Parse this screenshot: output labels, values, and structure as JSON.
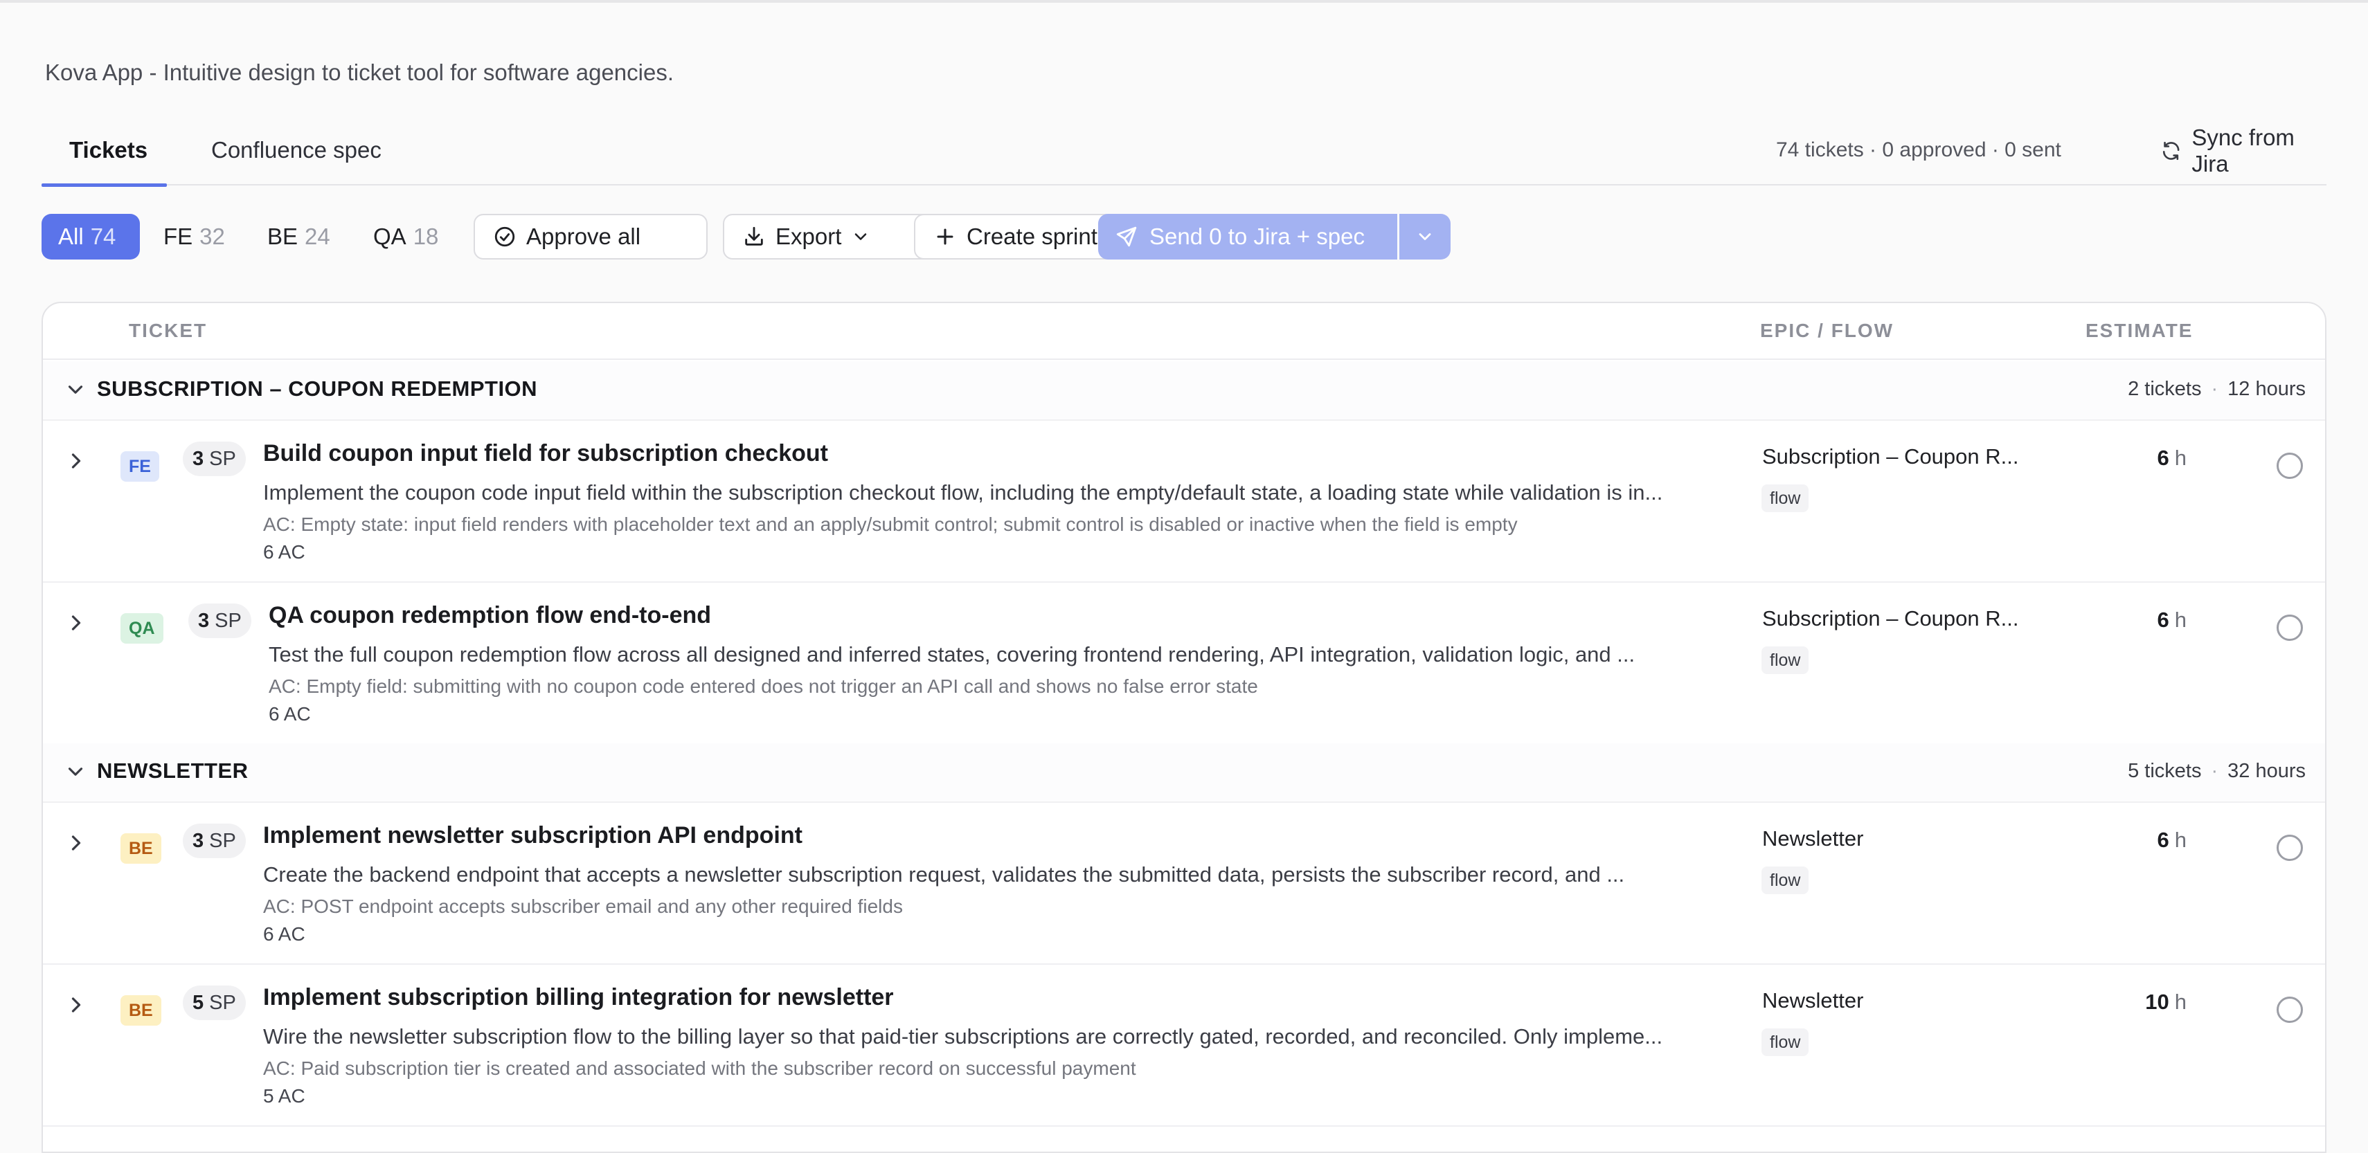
{
  "header": {
    "subtitle": "Kova App - Intuitive design to ticket tool for software agencies."
  },
  "tabs": {
    "tickets": "Tickets",
    "confluence": "Confluence spec",
    "stats": "74 tickets · 0 approved · 0 sent",
    "sync_label": "Sync from Jira"
  },
  "filters": {
    "all": {
      "label": "All",
      "count": "74"
    },
    "fe": {
      "label": "FE",
      "count": "32"
    },
    "be": {
      "label": "BE",
      "count": "24"
    },
    "qa": {
      "label": "QA",
      "count": "18"
    }
  },
  "actions": {
    "approve_all": "Approve all",
    "export": "Export",
    "create_sprint": "Create sprint",
    "send": "Send 0 to Jira + spec"
  },
  "table": {
    "col_ticket": "TICKET",
    "col_epic": "EPIC / FLOW",
    "col_estimate": "ESTIMATE"
  },
  "groups": [
    {
      "name": "SUBSCRIPTION – COUPON REDEMPTION",
      "tickets": "2 tickets",
      "hours": "12 hours"
    },
    {
      "name": "NEWSLETTER",
      "tickets": "5 tickets",
      "hours": "32 hours"
    }
  ],
  "rows": [
    {
      "type": "FE",
      "sp_value": "3",
      "sp_unit": "SP",
      "title": "Build coupon input field for subscription checkout",
      "desc": "Implement the coupon code input field within the subscription checkout flow, including the empty/default state, a loading state while validation is in...",
      "ac": "AC: Empty state: input field renders with placeholder text and an apply/submit control; submit control is disabled or inactive when the field is empty",
      "ac_count": "6 AC",
      "epic": "Subscription – Coupon R...",
      "flow": "flow",
      "est_value": "6",
      "est_unit": "h"
    },
    {
      "type": "QA",
      "sp_value": "3",
      "sp_unit": "SP",
      "title": "QA coupon redemption flow end-to-end",
      "desc": "Test the full coupon redemption flow across all designed and inferred states, covering frontend rendering, API integration, validation logic, and ...",
      "ac": "AC: Empty field: submitting with no coupon code entered does not trigger an API call and shows no false error state",
      "ac_count": "6 AC",
      "epic": "Subscription – Coupon R...",
      "flow": "flow",
      "est_value": "6",
      "est_unit": "h"
    },
    {
      "type": "BE",
      "sp_value": "3",
      "sp_unit": "SP",
      "title": "Implement newsletter subscription API endpoint",
      "desc": "Create the backend endpoint that accepts a newsletter subscription request, validates the submitted data, persists the subscriber record, and ...",
      "ac": "AC: POST endpoint accepts subscriber email and any other required fields",
      "ac_count": "6 AC",
      "epic": "Newsletter",
      "flow": "flow",
      "est_value": "6",
      "est_unit": "h"
    },
    {
      "type": "BE",
      "sp_value": "5",
      "sp_unit": "SP",
      "title": "Implement subscription billing integration for newsletter",
      "desc": "Wire the newsletter subscription flow to the billing layer so that paid-tier subscriptions are correctly gated, recorded, and reconciled. Only impleme...",
      "ac": "AC: Paid subscription tier is created and associated with the subscriber record on successful payment",
      "ac_count": "5 AC",
      "epic": "Newsletter",
      "flow": "flow",
      "est_value": "10",
      "est_unit": "h"
    }
  ]
}
